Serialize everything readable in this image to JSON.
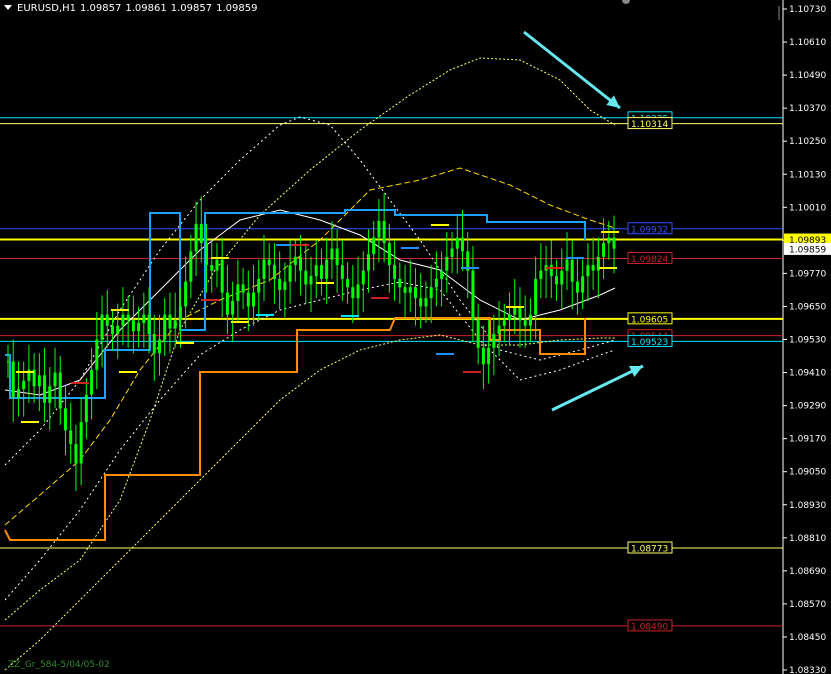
{
  "header": {
    "symbol": "EURUSD,H1",
    "open": "1.09857",
    "high": "1.09861",
    "low": "1.09857",
    "close": "1.09859"
  },
  "footer": {
    "text": "ZZ_Gr_584-5/04/05-02"
  },
  "colors": {
    "background": "#000000",
    "candle": "#00ff00",
    "ma_white": "#ffffff",
    "band_yellow": "#ffff66",
    "envelope_white": "#cccccc",
    "zigzag_yellow": "#ffd700",
    "blue_level": "#1e90ff",
    "orange_level": "#ff8c00",
    "red_level": "#cc2222",
    "cyan_arrow": "#66e8f0"
  },
  "chart_data": {
    "type": "candlestick",
    "symbol": "EURUSD",
    "timeframe": "H1",
    "ylim": [
      1.0826,
      1.0739
    ],
    "y_axis_ticks": [
      "1.10730",
      "1.10610",
      "1.10490",
      "1.10370",
      "1.10250",
      "1.10130",
      "1.10010",
      "1.09890",
      "1.09770",
      "1.09650",
      "1.09530",
      "1.09410",
      "1.09290",
      "1.09170",
      "1.09050",
      "1.08930",
      "1.08810",
      "1.08690",
      "1.08570",
      "1.08450",
      "1.08330"
    ],
    "current_price": {
      "label": "1.09859",
      "value": 1.09859
    },
    "price_tags": [
      {
        "label": "1.09893",
        "value": 1.09893,
        "color": "#ffff00"
      },
      {
        "label": "1.10335",
        "value": 1.10335,
        "color": "#00e5ff"
      },
      {
        "label": "1.10314",
        "value": 1.10314,
        "color": "#ffff66"
      },
      {
        "label": "1.09932",
        "value": 1.09932,
        "color": "#3050ff"
      },
      {
        "label": "1.09824",
        "value": 1.09824,
        "color": "#cc2222"
      },
      {
        "label": "1.09605",
        "value": 1.09605,
        "color": "#ffff00"
      },
      {
        "label": "1.09544",
        "value": 1.09544,
        "color": "#cc2222"
      },
      {
        "label": "1.09523",
        "value": 1.09523,
        "color": "#00e5ff"
      },
      {
        "label": "1.08773",
        "value": 1.08773,
        "color": "#ffff66"
      },
      {
        "label": "1.08490",
        "value": 1.0849,
        "color": "#cc2222"
      }
    ],
    "close_path": [
      1.0945,
      1.0932,
      1.0935,
      1.0938,
      1.0942,
      1.0936,
      1.094,
      1.093,
      1.0936,
      1.0941,
      1.0928,
      1.092,
      1.0915,
      1.0908,
      1.0923,
      1.0933,
      1.0942,
      1.0953,
      1.0962,
      1.0958,
      1.0955,
      1.0958,
      1.0962,
      1.096,
      1.0956,
      1.0959,
      1.0962,
      1.0955,
      1.0948,
      1.0953,
      1.0962,
      1.0957,
      1.096,
      1.0965,
      1.0974,
      1.0985,
      1.0995,
      1.0988,
      1.098,
      1.0978,
      1.0982,
      1.097,
      1.0962,
      1.0967,
      1.0973,
      1.097,
      1.0965,
      1.097,
      1.0975,
      1.0982,
      1.098,
      1.0975,
      1.0971,
      1.0974,
      1.098,
      1.0983,
      1.0978,
      1.0973,
      1.0976,
      1.098,
      1.0975,
      1.0982,
      1.0986,
      1.098,
      1.0975,
      1.0972,
      1.0968,
      1.0973,
      1.0978,
      1.0984,
      1.099,
      1.0996,
      1.0988,
      1.098,
      1.0975,
      1.0972,
      1.097,
      1.0972,
      1.0968,
      1.0965,
      1.0968,
      1.0972,
      1.0975,
      1.0978,
      1.0983,
      1.0986,
      1.099,
      1.0985,
      1.0978,
      1.096,
      1.095,
      1.0944,
      1.095,
      1.0955,
      1.0958,
      1.096,
      1.0962,
      1.0965,
      1.096,
      1.0958,
      1.0962,
      1.0975,
      1.0978,
      1.098,
      1.0976,
      1.0973,
      1.0978,
      1.0982,
      1.0974,
      1.097,
      1.0976,
      1.098,
      1.0978,
      1.0983,
      1.0988,
      1.099,
      1.0986
    ]
  }
}
